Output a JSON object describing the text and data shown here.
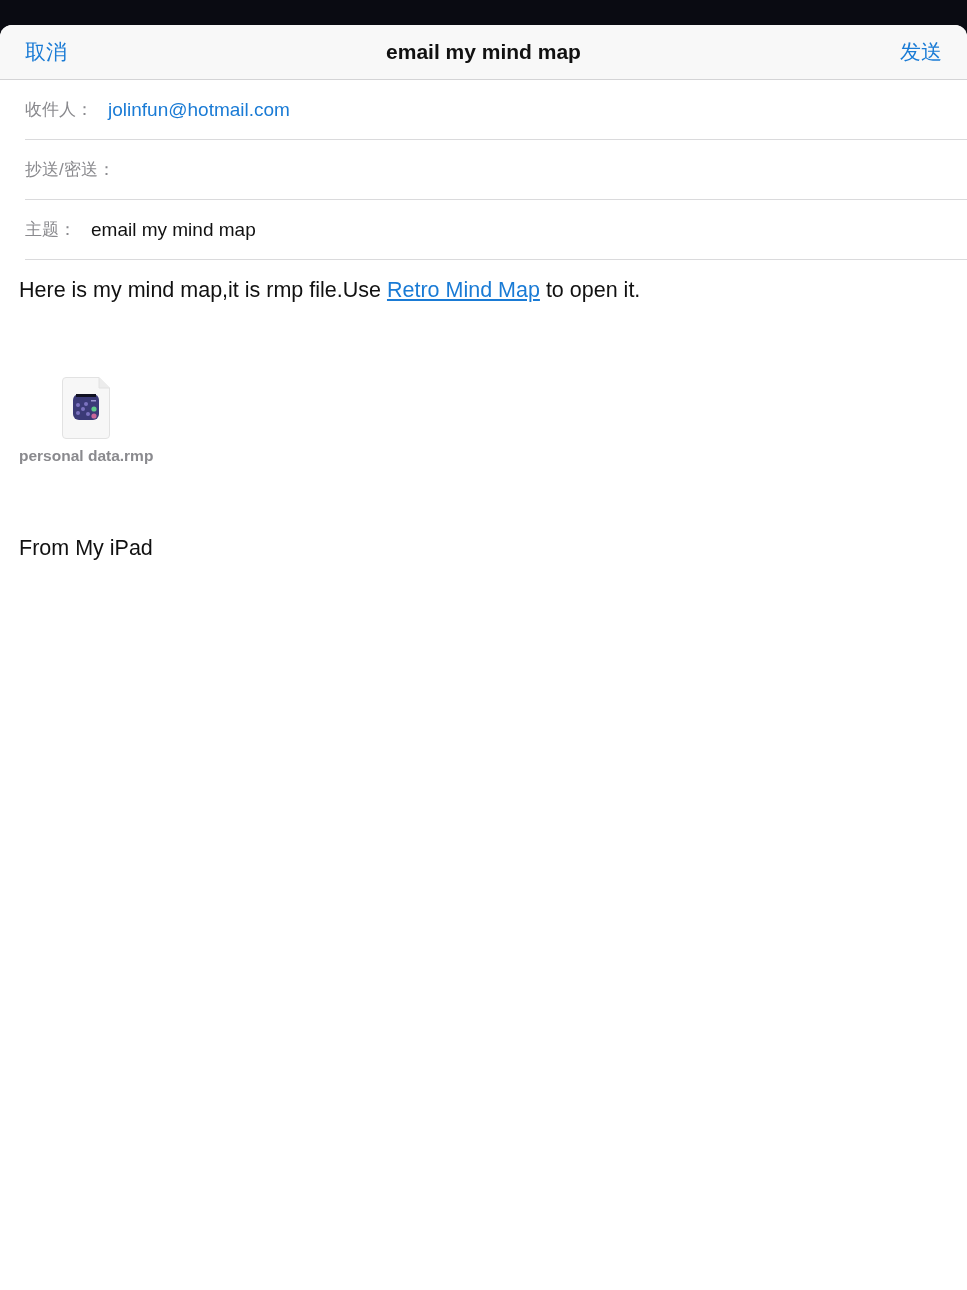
{
  "header": {
    "cancel": "取消",
    "title": "email my mind map",
    "send": "发送"
  },
  "fields": [
    {
      "kind": "recipient",
      "label": "收件人：",
      "value": "jolinfun@hotmail.com"
    },
    {
      "kind": "cc",
      "label": "抄送/密送："
    },
    {
      "kind": "subject",
      "label": "主题：",
      "value": "email my mind map"
    }
  ],
  "body": {
    "message_start": "Here is my mind map,it is rmp file.Use ",
    "link": "Retro Mind Map",
    "message_end": " to open it.",
    "attachment": {
      "filename": "personal data.rmp"
    },
    "signature": "From My iPad"
  }
}
